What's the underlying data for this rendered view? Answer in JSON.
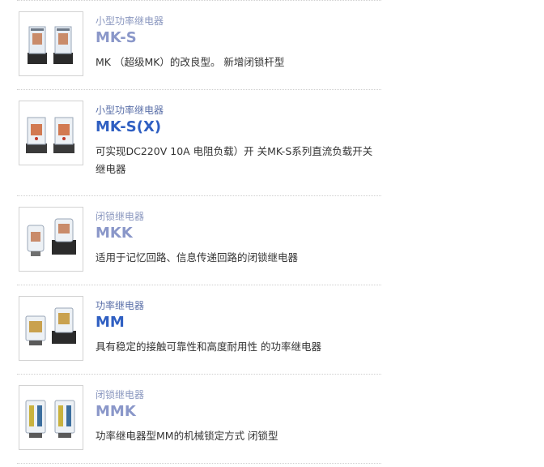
{
  "products": [
    {
      "category": "小型功率继电器",
      "name": "MK-S",
      "description": "MK （超级MK）的改良型。 新增闭锁杆型",
      "image_icon": "relay-product-photo-icon"
    },
    {
      "category": "小型功率继电器",
      "name": "MK-S(X)",
      "description": "可实现DC220V 10A 电阻负载）开 关MK-S系列直流负载开关继电器",
      "image_icon": "relay-product-photo-icon"
    },
    {
      "category": "闭锁继电器",
      "name": "MKK",
      "description": "适用于记忆回路、信息传递回路的闭锁继电器",
      "image_icon": "relay-product-photo-icon"
    },
    {
      "category": "功率继电器",
      "name": "MM",
      "description": "具有稳定的接触可靠性和高度耐用性 的功率继电器",
      "image_icon": "relay-product-photo-icon"
    },
    {
      "category": "闭锁继电器",
      "name": "MMK",
      "description": "功率继电器型MM的机械锁定方式 闭锁型",
      "image_icon": "relay-product-photo-icon"
    }
  ],
  "colors": {
    "category_link": "#5a6fa8",
    "title_light": "#8a97c9",
    "title_strong": "#2f5fc2",
    "description_text": "#333333",
    "divider": "#cfcfcf"
  }
}
